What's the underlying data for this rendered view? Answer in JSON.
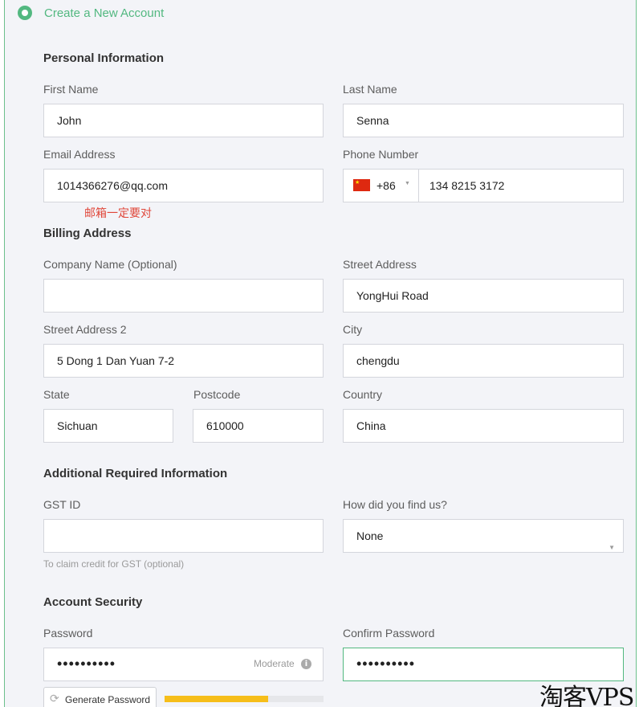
{
  "header": {
    "title": "Create a New Account"
  },
  "personal": {
    "section_title": "Personal Information",
    "first_name_label": "First Name",
    "first_name_value": "John",
    "last_name_label": "Last Name",
    "last_name_value": "Senna",
    "email_label": "Email Address",
    "email_value": "1014366276@qq.com",
    "email_note": "邮箱一定要对",
    "phone_label": "Phone Number",
    "phone_country_code": "+86",
    "phone_value": "134 8215 3172"
  },
  "billing": {
    "section_title": "Billing Address",
    "company_label": "Company Name (Optional)",
    "company_value": "",
    "street_label": "Street Address",
    "street_value": "YongHui Road",
    "street2_label": "Street Address 2",
    "street2_value": "5 Dong 1 Dan Yuan 7-2",
    "city_label": "City",
    "city_value": "chengdu",
    "state_label": "State",
    "state_value": "Sichuan",
    "postcode_label": "Postcode",
    "postcode_value": "610000",
    "country_label": "Country",
    "country_value": "China"
  },
  "additional": {
    "section_title": "Additional Required Information",
    "gst_label": "GST ID",
    "gst_value": "",
    "gst_help": "To claim credit for GST (optional)",
    "find_us_label": "How did you find us?",
    "find_us_value": "None"
  },
  "security": {
    "section_title": "Account Security",
    "password_label": "Password",
    "password_value": "••••••••••",
    "password_strength": "Moderate",
    "confirm_label": "Confirm Password",
    "confirm_value": "••••••••••",
    "generate_label": "Generate Password",
    "strength_fraction": 0.65
  },
  "icons": {
    "info": "info-icon",
    "refresh": "refresh-icon",
    "flag": "china-flag-icon"
  },
  "colors": {
    "accent": "#52b880",
    "strength_bar": "#f6be1a",
    "note": "#e0473a"
  },
  "watermark": "淘客VPS"
}
